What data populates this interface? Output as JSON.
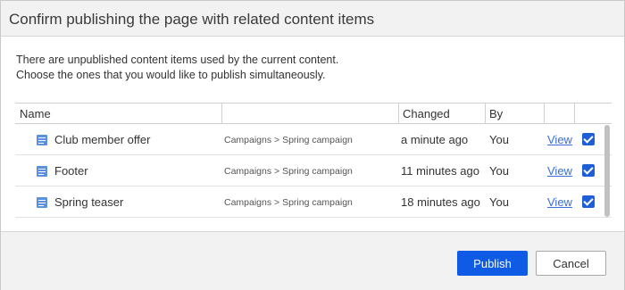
{
  "dialog": {
    "title": "Confirm publishing the page with related content items",
    "description_line1": "There are unpublished content items used by the current content.",
    "description_line2": "Choose the ones that you would like to publish simultaneously."
  },
  "grid": {
    "columns": {
      "name": "Name",
      "path": "",
      "changed": "Changed",
      "by": "By"
    },
    "rows": [
      {
        "name": "Club member offer",
        "path": "Campaigns > Spring campaign",
        "changed": "a minute ago",
        "by": "You",
        "view": "View",
        "checked": true
      },
      {
        "name": "Footer",
        "path": "Campaigns > Spring campaign",
        "changed": "11 minutes ago",
        "by": "You",
        "view": "View",
        "checked": true
      },
      {
        "name": "Spring teaser",
        "path": "Campaigns > Spring campaign",
        "changed": "18 minutes ago",
        "by": "You",
        "view": "View",
        "checked": true
      }
    ]
  },
  "footer": {
    "publish_label": "Publish",
    "cancel_label": "Cancel"
  },
  "colors": {
    "accent": "#0f5be6",
    "link": "#3a6fd8",
    "page_icon": "#5b8fe0"
  },
  "icons": {
    "row_icon": "page-icon",
    "checkbox": "checkbox-checked-icon"
  }
}
